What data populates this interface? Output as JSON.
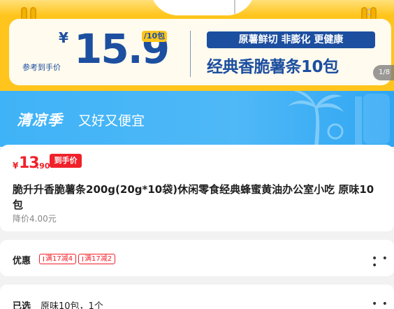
{
  "banner": {
    "currency": "¥",
    "ref_label": "参考到手价",
    "price": "15.9",
    "unit": "/10包",
    "pill": "原薯鲜切 非膨化 更健康",
    "headline": "经典香脆薯条10包",
    "counter": "1/8",
    "colors": {
      "background": "#ffc51c",
      "card": "#fffbee",
      "brand_blue": "#1d4fa0"
    }
  },
  "promo": {
    "title": "清凉季",
    "subtitle": "又好又便宜",
    "decoration": "palm-tree-icon",
    "color": "#3fb3f7"
  },
  "product": {
    "currency": "¥",
    "price_int": "13",
    "price_dec": ".90",
    "price_tag": "到手价",
    "title": "脆升升香脆薯条200g(20g*10袋)休闲零食经典蜂蜜黄油办公室小吃 原味10包",
    "orig_price": "降价4.00元",
    "accent_color": "#f0212a"
  },
  "offers": {
    "label": "优惠",
    "coupons": [
      "满17减4",
      "满17减2"
    ],
    "more_icon": "more-dots-icon"
  },
  "selected": {
    "label": "已选",
    "value": "原味10包，1个",
    "more_icon": "more-dots-icon"
  }
}
